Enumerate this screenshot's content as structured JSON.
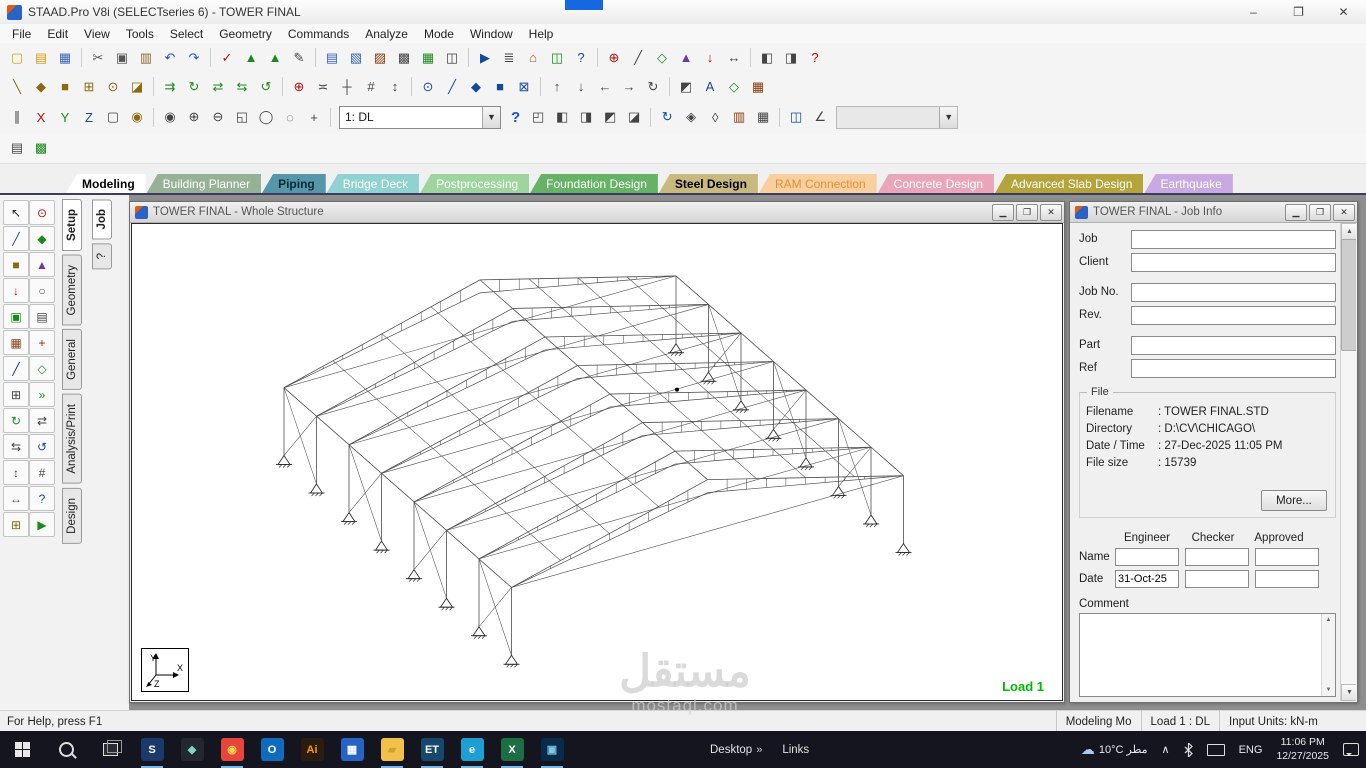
{
  "titlebar": {
    "title": "STAAD.Pro V8i (SELECTseries 6) - TOWER FINAL",
    "minimize": "–",
    "maximize": "❐",
    "close": "✕"
  },
  "menu": [
    "File",
    "Edit",
    "View",
    "Tools",
    "Select",
    "Geometry",
    "Commands",
    "Analyze",
    "Mode",
    "Window",
    "Help"
  ],
  "toolbars": {
    "row1": [
      {
        "n": "new-file",
        "g": "▢",
        "c": "#d8a018"
      },
      {
        "n": "open-file",
        "g": "▤",
        "c": "#d8a018"
      },
      {
        "n": "save-file",
        "g": "▦",
        "c": "#3a62b8"
      },
      {
        "sep": true
      },
      {
        "n": "cut",
        "g": "✂",
        "c": "#555555"
      },
      {
        "n": "copy",
        "g": "▣",
        "c": "#555555"
      },
      {
        "n": "paste",
        "g": "▥",
        "c": "#8a6a30"
      },
      {
        "n": "undo",
        "g": "↶",
        "c": "#2a52c8"
      },
      {
        "n": "redo",
        "g": "↷",
        "c": "#2a52c8"
      },
      {
        "sep": true
      },
      {
        "n": "spell-check",
        "g": "✓",
        "c": "#b01010"
      },
      {
        "n": "sort-ascending",
        "g": "▲",
        "c": "#1a8a1a"
      },
      {
        "n": "sort-descending",
        "g": "▲",
        "c": "#1a8a1a"
      },
      {
        "n": "edit-input",
        "g": "✎",
        "c": "#444444"
      },
      {
        "sep": true
      },
      {
        "n": "print",
        "g": "▤",
        "c": "#3a62b8"
      },
      {
        "n": "print-preview",
        "g": "▧",
        "c": "#3a62b8"
      },
      {
        "n": "print-report",
        "g": "▨",
        "c": "#8a3a10"
      },
      {
        "n": "report-setup",
        "g": "▩",
        "c": "#444444"
      },
      {
        "n": "export-view",
        "g": "▦",
        "c": "#1a8a1a"
      },
      {
        "n": "screen-capture",
        "g": "◫",
        "c": "#444444"
      },
      {
        "sep": true
      },
      {
        "n": "run-analysis",
        "g": "▶",
        "c": "#14489a"
      },
      {
        "n": "staad-editor",
        "g": "≣",
        "c": "#444444"
      },
      {
        "n": "structure-wizard",
        "g": "⌂",
        "c": "#8a5a10"
      },
      {
        "n": "open-table",
        "g": "◫",
        "c": "#1a8a1a"
      },
      {
        "n": "query",
        "g": "?",
        "c": "#14489a"
      },
      {
        "sep": true
      },
      {
        "n": "insert-node",
        "g": "⊕",
        "c": "#b01010"
      },
      {
        "n": "add-beam",
        "g": "╱",
        "c": "#444444"
      },
      {
        "n": "add-plate",
        "g": "◇",
        "c": "#1a8a1a"
      },
      {
        "n": "support-tool",
        "g": "▲",
        "c": "#6a3aa0"
      },
      {
        "n": "load-tool",
        "g": "↓",
        "c": "#b01010"
      },
      {
        "n": "dimension-tool",
        "g": "↔",
        "c": "#444444"
      },
      {
        "sep": true
      },
      {
        "n": "view-management",
        "g": "◧",
        "c": "#444444"
      },
      {
        "n": "save-view",
        "g": "◨",
        "c": "#444444"
      },
      {
        "n": "help",
        "g": "?",
        "c": "#c00000"
      }
    ],
    "row2": [
      {
        "n": "beam-grid",
        "g": "╲",
        "c": "#8a6a10"
      },
      {
        "n": "plate-grid",
        "g": "◆",
        "c": "#8a6a10"
      },
      {
        "n": "solid-grid",
        "g": "■",
        "c": "#8a6a10"
      },
      {
        "n": "node-grid",
        "g": "⊞",
        "c": "#8a6a10"
      },
      {
        "n": "snap-node-beam",
        "g": "⊙",
        "c": "#8a6a10"
      },
      {
        "n": "snap-node-plate",
        "g": "◪",
        "c": "#8a6a10"
      },
      {
        "sep": true
      },
      {
        "n": "translational-repeat",
        "g": "⇉",
        "c": "#1a8a1a"
      },
      {
        "n": "circular-repeat",
        "g": "↻",
        "c": "#1a8a1a"
      },
      {
        "n": "move-entities",
        "g": "⇄",
        "c": "#1a8a1a"
      },
      {
        "n": "mirror-entities",
        "g": "⇆",
        "c": "#1a8a1a"
      },
      {
        "n": "rotate-entities",
        "g": "↺",
        "c": "#1a8a1a"
      },
      {
        "sep": true
      },
      {
        "n": "insert-node-tool",
        "g": "⊕",
        "c": "#b01010"
      },
      {
        "n": "merge-beams",
        "g": "≍",
        "c": "#444444"
      },
      {
        "n": "split-beam",
        "g": "┼",
        "c": "#444444"
      },
      {
        "n": "renumber",
        "g": "#",
        "c": "#444444"
      },
      {
        "n": "stretch-beam",
        "g": "↕",
        "c": "#444444"
      },
      {
        "sep": true
      },
      {
        "n": "select-nodes",
        "g": "⊙",
        "c": "#14489a"
      },
      {
        "n": "select-beams",
        "g": "╱",
        "c": "#14489a"
      },
      {
        "n": "select-plates",
        "g": "◆",
        "c": "#14489a"
      },
      {
        "n": "select-solids",
        "g": "■",
        "c": "#14489a"
      },
      {
        "n": "select-all",
        "g": "⊠",
        "c": "#14489a"
      },
      {
        "sep": true
      },
      {
        "n": "rotate-up",
        "g": "↑",
        "c": "#444444"
      },
      {
        "n": "rotate-down",
        "g": "↓",
        "c": "#444444"
      },
      {
        "n": "rotate-left",
        "g": "←",
        "c": "#444444"
      },
      {
        "n": "rotate-right",
        "g": "→",
        "c": "#444444"
      },
      {
        "n": "spin-view",
        "g": "↻",
        "c": "#444444"
      },
      {
        "sep": true
      },
      {
        "n": "display-options",
        "g": "◩",
        "c": "#444444"
      },
      {
        "n": "labels-toggle",
        "g": "A",
        "c": "#14489a"
      },
      {
        "n": "structure-diagrams",
        "g": "◇",
        "c": "#1a8a1a"
      },
      {
        "n": "render-view",
        "g": "▦",
        "c": "#8a3a10"
      }
    ],
    "row3_left": [
      {
        "n": "filter-parallel",
        "g": "∥",
        "c": "#444444"
      },
      {
        "n": "select-x-axis",
        "g": "X",
        "c": "#b01010"
      },
      {
        "n": "select-y-axis",
        "g": "Y",
        "c": "#1a8a1a"
      },
      {
        "n": "select-z-axis",
        "g": "Z",
        "c": "#14489a"
      },
      {
        "n": "select-window",
        "g": "▢",
        "c": "#444444"
      },
      {
        "n": "highlight-mode",
        "g": "◉",
        "c": "#8a6a10"
      },
      {
        "sep": true
      },
      {
        "n": "dynamic-zoom",
        "g": "◉",
        "c": "#444444"
      },
      {
        "n": "zoom-in",
        "g": "⊕",
        "c": "#444444"
      },
      {
        "n": "zoom-out",
        "g": "⊖",
        "c": "#444444"
      },
      {
        "n": "zoom-window",
        "g": "◱",
        "c": "#444444"
      },
      {
        "n": "zoom-extents",
        "g": "◯",
        "c": "#444444"
      },
      {
        "n": "zoom-previous",
        "g": "◌",
        "c": "#444444"
      },
      {
        "n": "pan",
        "g": "+",
        "c": "#444444"
      },
      {
        "sep": true
      }
    ],
    "row3_right": [
      {
        "n": "view-whole-structure",
        "g": "◰",
        "c": "#444444"
      },
      {
        "n": "view-front",
        "g": "◧",
        "c": "#444444"
      },
      {
        "n": "view-side",
        "g": "◨",
        "c": "#444444"
      },
      {
        "n": "view-top",
        "g": "◩",
        "c": "#444444"
      },
      {
        "n": "view-isometric",
        "g": "◪",
        "c": "#444444"
      },
      {
        "sep": true
      },
      {
        "n": "orbit-view",
        "g": "↻",
        "c": "#14489a"
      },
      {
        "n": "perspective-view",
        "g": "◈",
        "c": "#444444"
      },
      {
        "n": "shrink-members",
        "g": "◊",
        "c": "#444444"
      },
      {
        "n": "section-view",
        "g": "▥",
        "c": "#8a3a10"
      },
      {
        "n": "wireframe-toggle",
        "g": "▦",
        "c": "#444444"
      },
      {
        "sep": true
      },
      {
        "n": "cut-section",
        "g": "◫",
        "c": "#14489a"
      },
      {
        "n": "bend-tool",
        "g": "∠",
        "c": "#444444"
      }
    ],
    "row4": [
      {
        "n": "copy-picture",
        "g": "▤",
        "c": "#444444"
      },
      {
        "n": "open-editor",
        "g": "▩",
        "c": "#1a8a1a"
      }
    ],
    "load_combo_value": "1: DL",
    "help_label": "?"
  },
  "mode_tabs": [
    {
      "label": "Modeling",
      "bg": "#ffffff",
      "fg": "#000000",
      "bold": true
    },
    {
      "label": "Building Planner",
      "bg": "#96b296",
      "fg": "#ffffff"
    },
    {
      "label": "Piping",
      "bg": "#5596a8",
      "fg": "#0a2a3a",
      "bold": true
    },
    {
      "label": "Bridge Deck",
      "bg": "#8fd2cf",
      "fg": "#ffffff"
    },
    {
      "label": "Postprocessing",
      "bg": "#9ed49e",
      "fg": "#ffffff"
    },
    {
      "label": "Foundation Design",
      "bg": "#66b266",
      "fg": "#ffffff"
    },
    {
      "label": "Steel Design",
      "bg": "#c9b97e",
      "fg": "#000000",
      "bold": true
    },
    {
      "label": "RAM Connection",
      "bg": "#f8cf9f",
      "fg": "#e0903a"
    },
    {
      "label": "Concrete Design",
      "bg": "#e9a6b8",
      "fg": "#ffffff"
    },
    {
      "label": "Advanced Slab Design",
      "bg": "#b5a43c",
      "fg": "#ffffff"
    },
    {
      "label": "Earthquake",
      "bg": "#c9a9e2",
      "fg": "#ffffff"
    }
  ],
  "palette": [
    {
      "n": "select-cursor",
      "g": "↖",
      "c": "#222222"
    },
    {
      "n": "node-cursor",
      "g": "⊙",
      "c": "#b01010"
    },
    {
      "n": "beam-cursor",
      "g": "╱",
      "c": "#14489a"
    },
    {
      "n": "plate-cursor",
      "g": "◆",
      "c": "#1a8a1a"
    },
    {
      "n": "solid-cursor",
      "g": "■",
      "c": "#8a6a10"
    },
    {
      "n": "support-cursor",
      "g": "▲",
      "c": "#6a3aa0"
    },
    {
      "n": "load-cursor",
      "g": "↓",
      "c": "#b01010"
    },
    {
      "n": "release-cursor",
      "g": "○",
      "c": "#444444"
    },
    {
      "n": "property-cursor",
      "g": "▣",
      "c": "#1a8a1a"
    },
    {
      "n": "spec-cursor",
      "g": "▤",
      "c": "#444444"
    },
    {
      "n": "material-cursor",
      "g": "▦",
      "c": "#8a3a10"
    },
    {
      "n": "add-node",
      "g": "+",
      "c": "#b01010"
    },
    {
      "n": "add-beam",
      "g": "╱",
      "c": "#00309a"
    },
    {
      "n": "add-plate",
      "g": "◇",
      "c": "#1a8a1a"
    },
    {
      "n": "mesh-generate",
      "g": "⊞",
      "c": "#444444"
    },
    {
      "n": "translational-repeat",
      "g": "»",
      "c": "#1a8a1a"
    },
    {
      "n": "circular-repeat",
      "g": "↻",
      "c": "#1a8a1a"
    },
    {
      "n": "move-tool",
      "g": "⇄",
      "c": "#444444"
    },
    {
      "n": "mirror-tool",
      "g": "⇆",
      "c": "#444444"
    },
    {
      "n": "rotate-tool",
      "g": "↺",
      "c": "#14489a"
    },
    {
      "n": "stretch-tool",
      "g": "↕",
      "c": "#444444"
    },
    {
      "n": "renumber-tool",
      "g": "#",
      "c": "#444444"
    },
    {
      "n": "dimension-tool",
      "g": "↔",
      "c": "#444444"
    },
    {
      "n": "query-tool",
      "g": "?",
      "c": "#14489a"
    },
    {
      "n": "calculator-tool",
      "g": "⊞",
      "c": "#8a6a10"
    },
    {
      "n": "run-analysis-tool",
      "g": "▶",
      "c": "#1a8a1a"
    }
  ],
  "sidebar": {
    "primary": [
      {
        "label": "Setup",
        "active": true
      },
      {
        "label": "Geometry",
        "active": false
      },
      {
        "label": "General",
        "active": false
      },
      {
        "label": "Analysis/Print",
        "active": false
      },
      {
        "label": "Design",
        "active": false
      }
    ],
    "secondary": [
      {
        "label": "Job",
        "active": true
      },
      {
        "label": "?",
        "active": false
      }
    ]
  },
  "structure_window": {
    "title": "TOWER FINAL - Whole Structure",
    "load_label": "Load 1",
    "axis": {
      "x": "X",
      "y": "Y",
      "z": "Z"
    }
  },
  "job_info": {
    "title": "TOWER FINAL - Job Info",
    "fields": [
      "Job",
      "Client",
      "Job No.",
      "Rev.",
      "Part",
      "Ref"
    ],
    "file": {
      "title": "File",
      "rows": [
        {
          "label": "Filename",
          "value": ": TOWER FINAL.STD"
        },
        {
          "label": "Directory",
          "value": ": D:\\CV\\CHICAGO\\"
        },
        {
          "label": "Date / Time",
          "value": ": 27-Dec-2025   11:05 PM"
        },
        {
          "label": "File size",
          "value": ": 15739"
        }
      ],
      "more": "More..."
    },
    "approval": {
      "headers": [
        "Engineer",
        "Checker",
        "Approved"
      ],
      "name_label": "Name",
      "date_label": "Date",
      "date_value": "31-Oct-25"
    },
    "comment_label": "Comment"
  },
  "status": {
    "help": "For Help, press F1",
    "mode": "Modeling Mo",
    "load": "Load 1 : DL",
    "units": "Input Units:  kN-m"
  },
  "taskbar": {
    "apps": [
      {
        "n": "staad-pro",
        "g": "S",
        "bg": "#1b3a6b",
        "c": "#ffffff",
        "run": true
      },
      {
        "n": "app-dark",
        "g": "◆",
        "bg": "#23272f",
        "c": "#7fd4c8",
        "run": false
      },
      {
        "n": "chrome",
        "g": "◉",
        "bg": "#e8453c",
        "c": "#f7d148",
        "run": true
      },
      {
        "n": "outlook",
        "g": "O",
        "bg": "#0f6cbd",
        "c": "#ffffff",
        "run": false
      },
      {
        "n": "illustrator",
        "g": "Ai",
        "bg": "#2a1d0e",
        "c": "#ff9a00",
        "run": false
      },
      {
        "n": "app-blue",
        "g": "▦",
        "bg": "#2563c4",
        "c": "#ffffff",
        "run": false
      },
      {
        "n": "folder",
        "g": "▰",
        "bg": "#f3c14b",
        "c": "#caa22e",
        "run": true
      },
      {
        "n": "app-et",
        "g": "ET",
        "bg": "#16486b",
        "c": "#ffffff",
        "run": true
      },
      {
        "n": "edge",
        "g": "e",
        "bg": "#1e9fd4",
        "c": "#ffffff",
        "run": true
      },
      {
        "n": "excel",
        "g": "X",
        "bg": "#1e6e43",
        "c": "#ffffff",
        "run": true
      },
      {
        "n": "photoshop",
        "g": "▣",
        "bg": "#0a2a4a",
        "c": "#7ec8e8",
        "run": true
      }
    ],
    "desktop_label": "Desktop",
    "links_label": "Links",
    "chevron": "»",
    "weather": "10°C مطر",
    "tray_chevron": "∧",
    "lang": "ENG",
    "time": "11:06 PM",
    "date": "12/27/2025"
  },
  "watermark": {
    "line1": "مستقل",
    "line2": "mostaql.com"
  }
}
